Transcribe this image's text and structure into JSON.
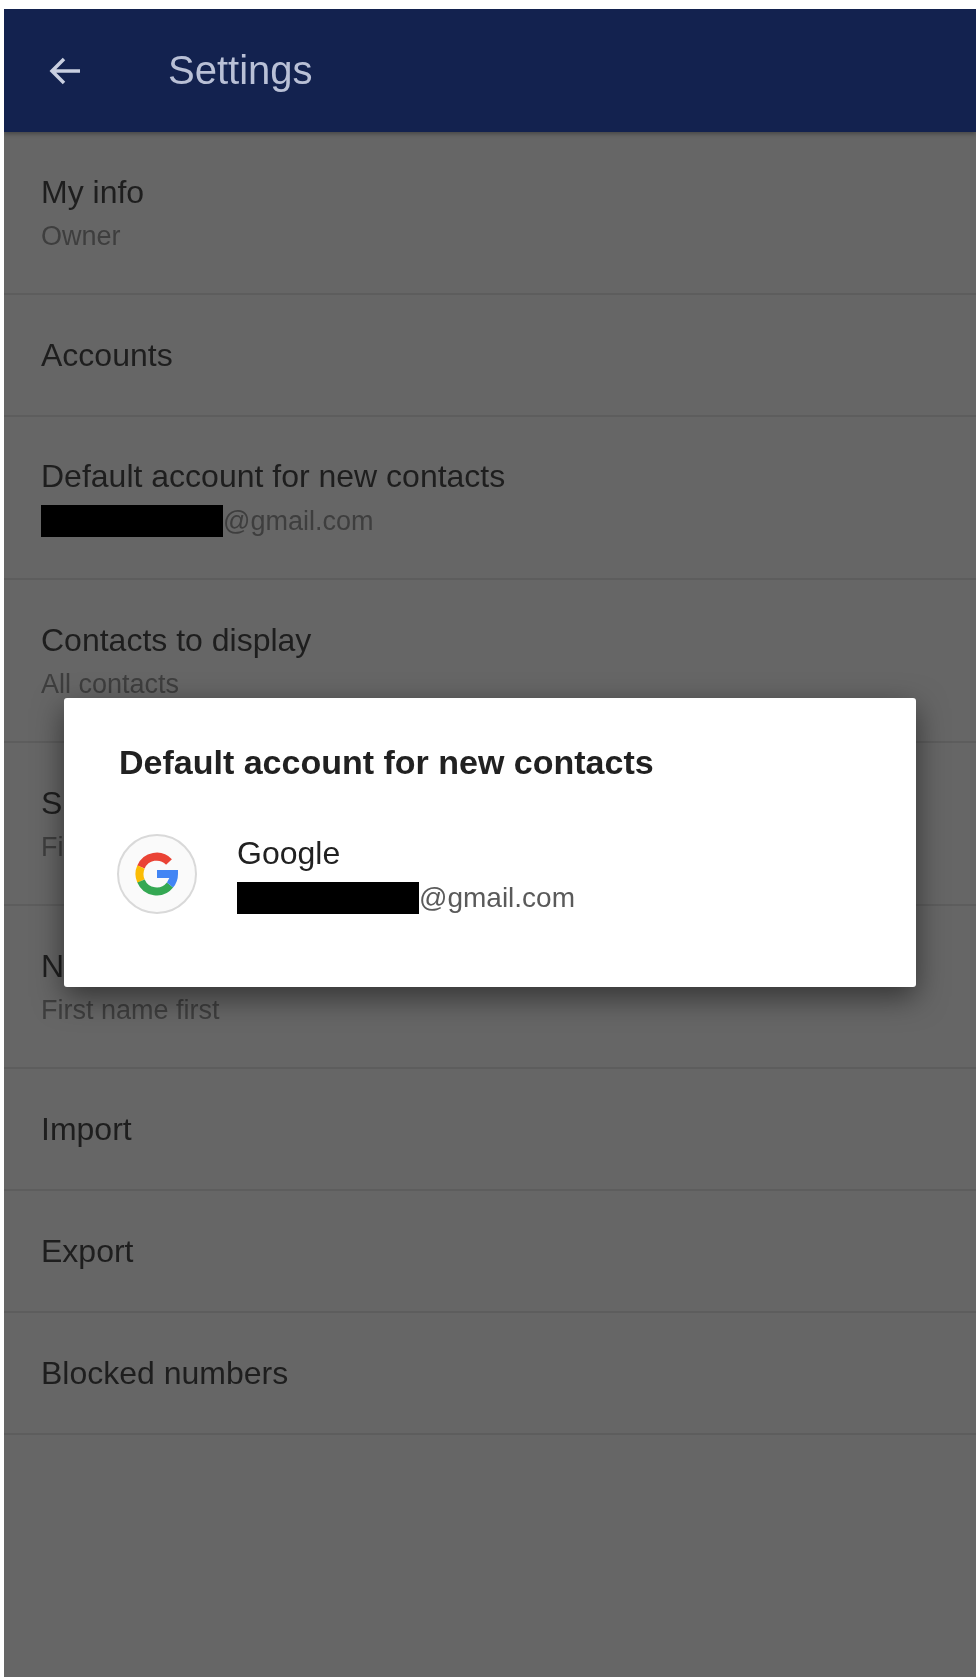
{
  "app_bar": {
    "title": "Settings"
  },
  "settings": [
    {
      "title": "My info",
      "subtitle": "Owner"
    },
    {
      "title": "Accounts"
    },
    {
      "title": "Default account for new contacts",
      "subtitle": "@gmail.com",
      "redacted": true
    },
    {
      "title": "Contacts to display",
      "subtitle": "All contacts"
    },
    {
      "title": "S",
      "subtitle": "Fi"
    },
    {
      "title": "N",
      "subtitle": "First name first"
    },
    {
      "title": "Import"
    },
    {
      "title": "Export"
    },
    {
      "title": "Blocked numbers"
    }
  ],
  "dialog": {
    "title": "Default account for new contacts",
    "accounts": [
      {
        "name": "Google",
        "email": "@gmail.com",
        "redacted": true
      }
    ]
  }
}
